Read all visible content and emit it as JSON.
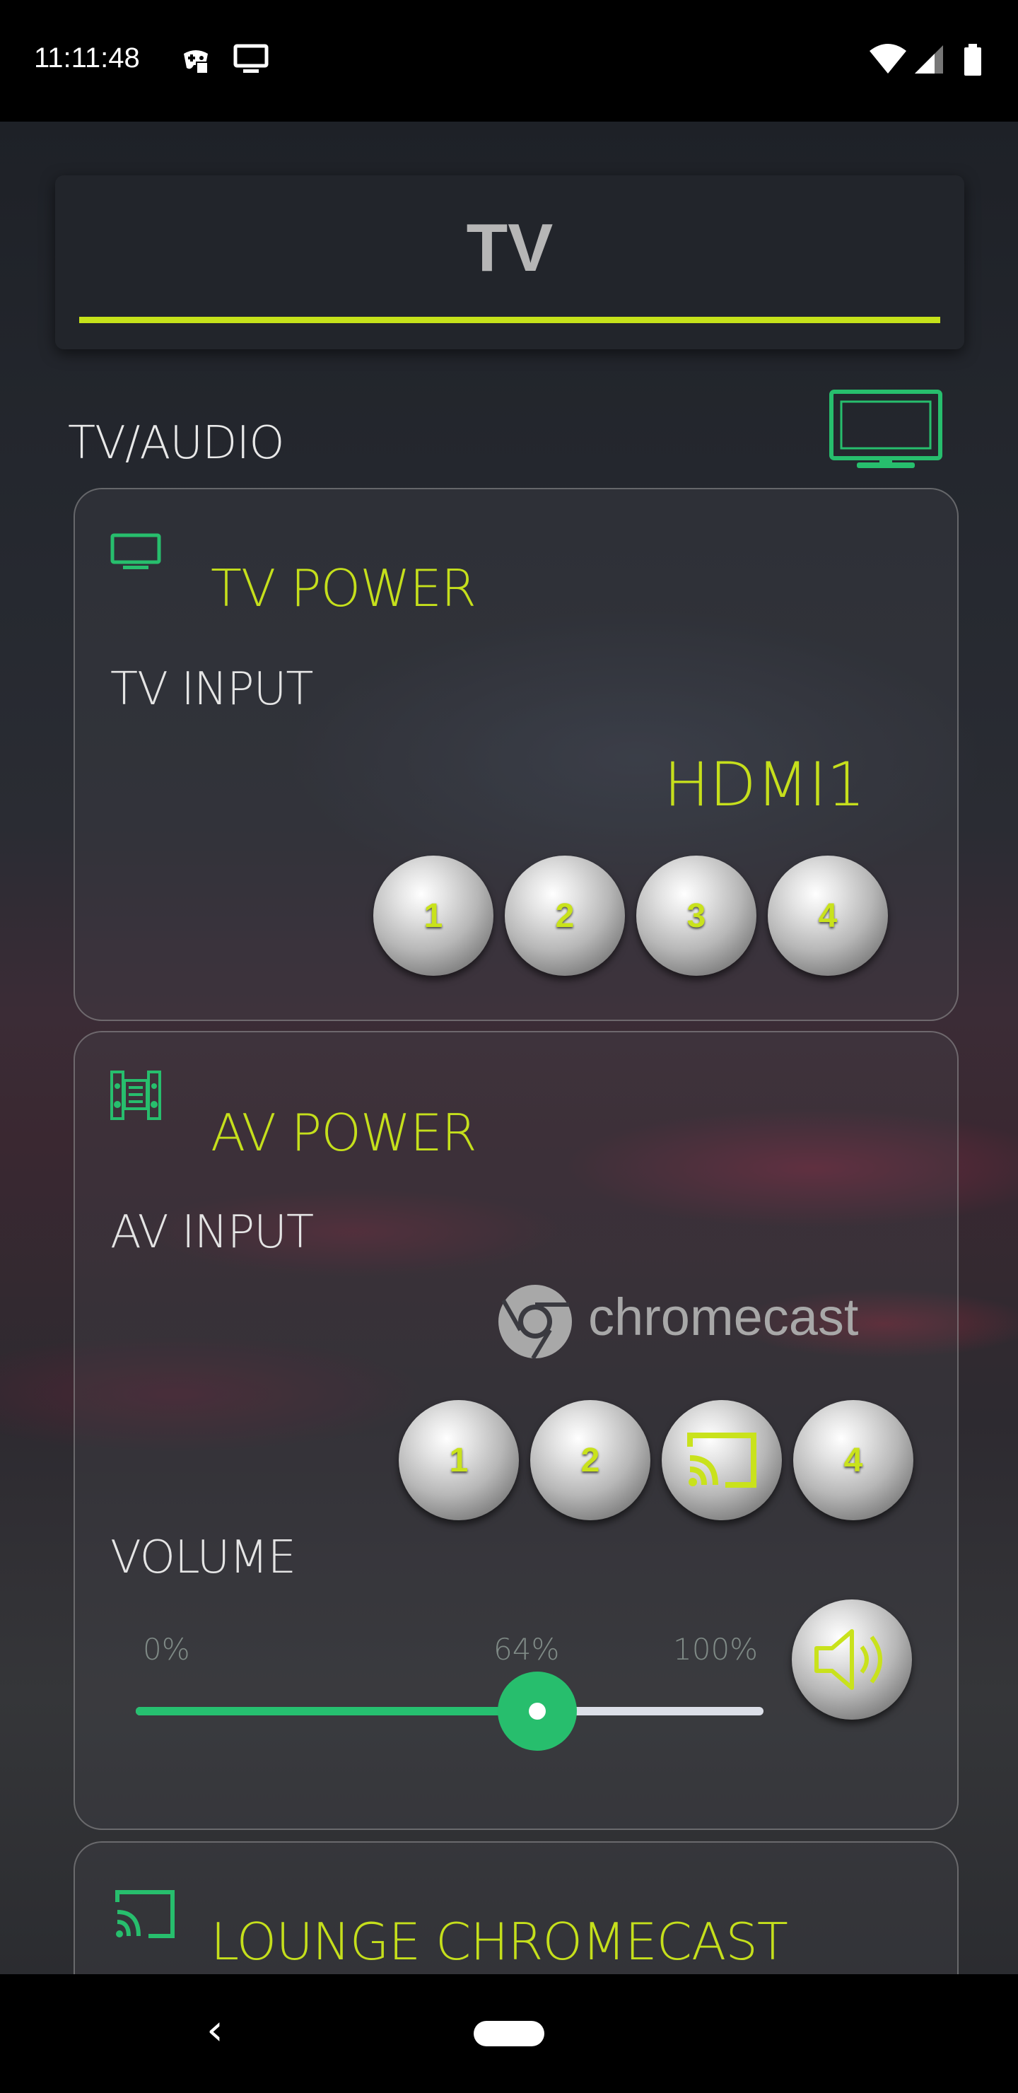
{
  "status_bar": {
    "time": "11:11:48"
  },
  "header": {
    "title": "TV"
  },
  "section": {
    "label": "TV/AUDIO",
    "icon": "tv-icon"
  },
  "tv_card": {
    "title": "TV POWER",
    "input_label": "TV INPUT",
    "input_value": "HDMI1",
    "buttons": [
      "1",
      "2",
      "3",
      "4"
    ]
  },
  "av_card": {
    "title": "AV POWER",
    "input_label": "AV INPUT",
    "input_value": "chromecast",
    "buttons": [
      "1",
      "2",
      "cast",
      "4"
    ],
    "volume_label": "VOLUME",
    "volume_min": "0%",
    "volume_current": "64%",
    "volume_max": "100%",
    "volume_level": 0.64
  },
  "chromecast_card": {
    "title": "LOUNGE CHROMECAST"
  },
  "colors": {
    "accent": "#c6e21a",
    "green": "#27be6d"
  }
}
